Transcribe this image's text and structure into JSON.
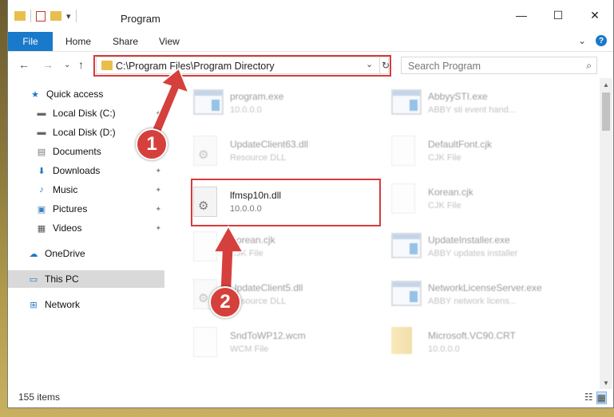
{
  "window": {
    "title": "Program",
    "controls": {
      "minimize": "—",
      "maximize": "☐",
      "close": "✕"
    }
  },
  "ribbon": {
    "tabs": [
      "File",
      "Home",
      "Share",
      "View"
    ],
    "expand_glyph": "⌄",
    "help_glyph": "?"
  },
  "nav": {
    "back": "←",
    "forward": "→",
    "recent": "⌄",
    "up": "↑"
  },
  "address": {
    "path": "C:\\Program Files\\Program Directory",
    "dropdown_glyph": "⌄",
    "refresh_glyph": "↻"
  },
  "search": {
    "placeholder": "Search Program",
    "icon_glyph": "⌕"
  },
  "sidebar": {
    "items": [
      {
        "label": "Quick access",
        "icon": "star-icon",
        "glyph": "★",
        "pinned": false
      },
      {
        "label": "Local Disk (C:)",
        "icon": "drive-icon",
        "glyph": "▬",
        "pinned": true
      },
      {
        "label": "Local Disk (D:)",
        "icon": "drive-icon",
        "glyph": "▬",
        "pinned": true
      },
      {
        "label": "Documents",
        "icon": "documents-icon",
        "glyph": "▤",
        "pinned": true
      },
      {
        "label": "Downloads",
        "icon": "download-icon",
        "glyph": "⬇",
        "pinned": true
      },
      {
        "label": "Music",
        "icon": "music-icon",
        "glyph": "♪",
        "pinned": true
      },
      {
        "label": "Pictures",
        "icon": "pictures-icon",
        "glyph": "▣",
        "pinned": true
      },
      {
        "label": "Videos",
        "icon": "videos-icon",
        "glyph": "▦",
        "pinned": true
      },
      {
        "label": "OneDrive",
        "icon": "cloud-icon",
        "glyph": "☁",
        "pinned": false
      },
      {
        "label": "This PC",
        "icon": "computer-icon",
        "glyph": "▭",
        "pinned": false
      },
      {
        "label": "Network",
        "icon": "network-icon",
        "glyph": "⊞",
        "pinned": false
      }
    ],
    "pin_glyph": "📌"
  },
  "files": [
    {
      "name": "program.exe",
      "sub": "10.0.0.0"
    },
    {
      "name": "AbbyySTI.exe",
      "sub": "ABBY sti event hand..."
    },
    {
      "name": "UpdateClient63.dll",
      "sub": "Resource DLL"
    },
    {
      "name": "DefaultFont.cjk",
      "sub": "CJK File"
    },
    {
      "name": "lfmsp10n.dll",
      "sub": "10.0.0.0"
    },
    {
      "name": "Korean.cjk",
      "sub": "CJK File"
    },
    {
      "name": "Korean.cjk",
      "sub": "CJK File"
    },
    {
      "name": "UpdateInstaller.exe",
      "sub": "ABBY updates installer"
    },
    {
      "name": "UpdateClient5.dll",
      "sub": "Resource DLL"
    },
    {
      "name": "NetworkLicenseServer.exe",
      "sub": "ABBY network licens..."
    },
    {
      "name": "SndToWP12.wcm",
      "sub": "WCM File"
    },
    {
      "name": "Microsoft.VC90.CRT",
      "sub": "10.0.0.0"
    }
  ],
  "status": {
    "item_count": "155 items"
  },
  "annotations": {
    "badge1": "1",
    "badge2": "2"
  },
  "colors": {
    "accent": "#1979ca",
    "highlight": "#d93a3a",
    "badge": "#d6403c"
  }
}
